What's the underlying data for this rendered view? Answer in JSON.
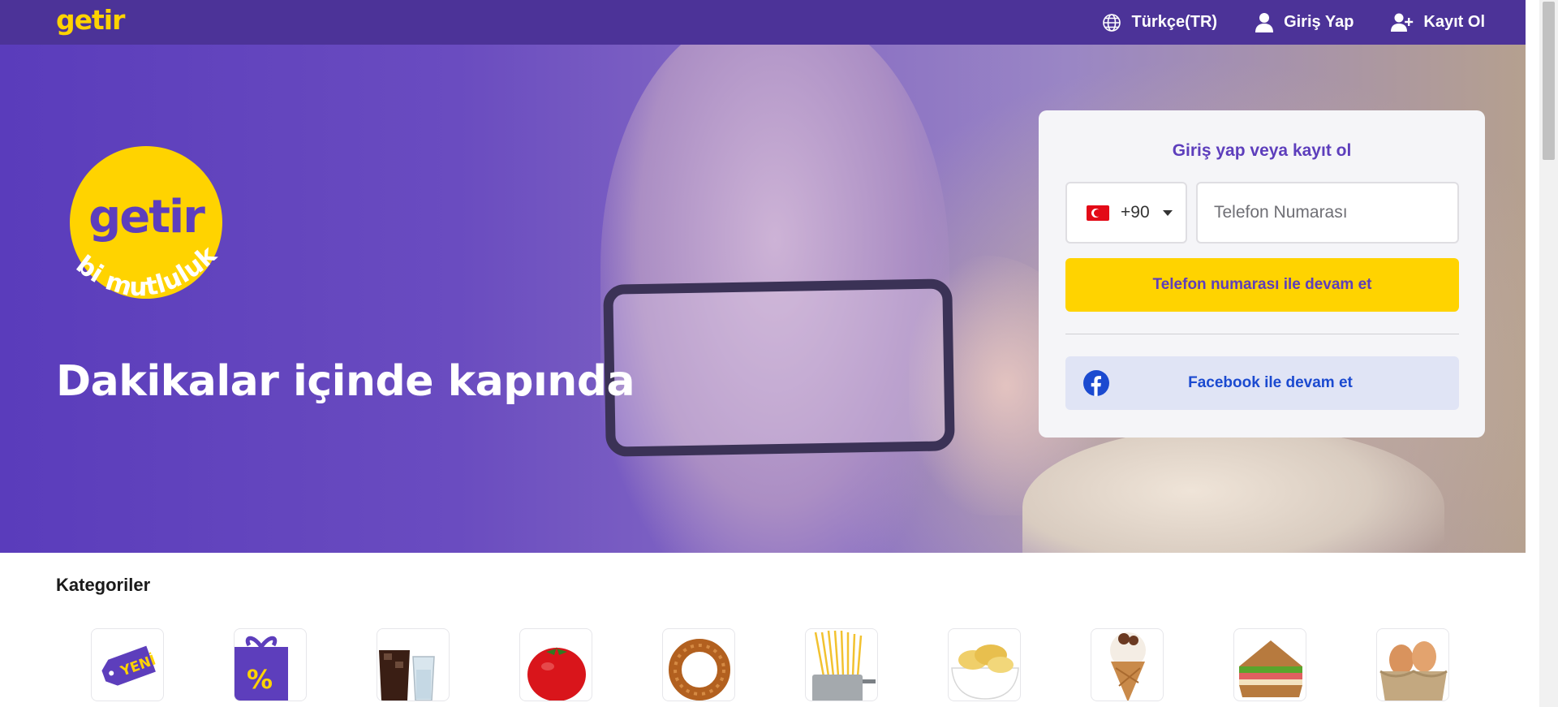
{
  "header": {
    "logo": "getir",
    "language_label": "Türkçe(TR)",
    "login_label": "Giriş Yap",
    "signup_label": "Kayıt Ol"
  },
  "hero": {
    "badge_logo": "getir",
    "badge_slogan": "bi mutluluk",
    "headline": "Dakikalar içinde kapında"
  },
  "login": {
    "title": "Giriş yap veya kayıt ol",
    "country_code": "+90",
    "phone_placeholder": "Telefon Numarası",
    "continue_label": "Telefon numarası ile devam et",
    "facebook_label": "Facebook ile devam et"
  },
  "categories": {
    "title": "Kategoriler",
    "items": [
      {
        "icon": "new-tag-icon",
        "text": "YENİ"
      },
      {
        "icon": "gift-discount-icon",
        "text": "%"
      },
      {
        "icon": "drinks-icon"
      },
      {
        "icon": "tomato-icon"
      },
      {
        "icon": "simit-icon"
      },
      {
        "icon": "pasta-icon"
      },
      {
        "icon": "chips-icon"
      },
      {
        "icon": "ice-cream-icon"
      },
      {
        "icon": "sandwich-icon"
      },
      {
        "icon": "eggs-icon"
      }
    ]
  },
  "colors": {
    "brand_purple": "#5d3ebc",
    "topbar_purple": "#4c3398",
    "brand_yellow": "#ffd300",
    "facebook_blue": "#1b4ad0"
  }
}
